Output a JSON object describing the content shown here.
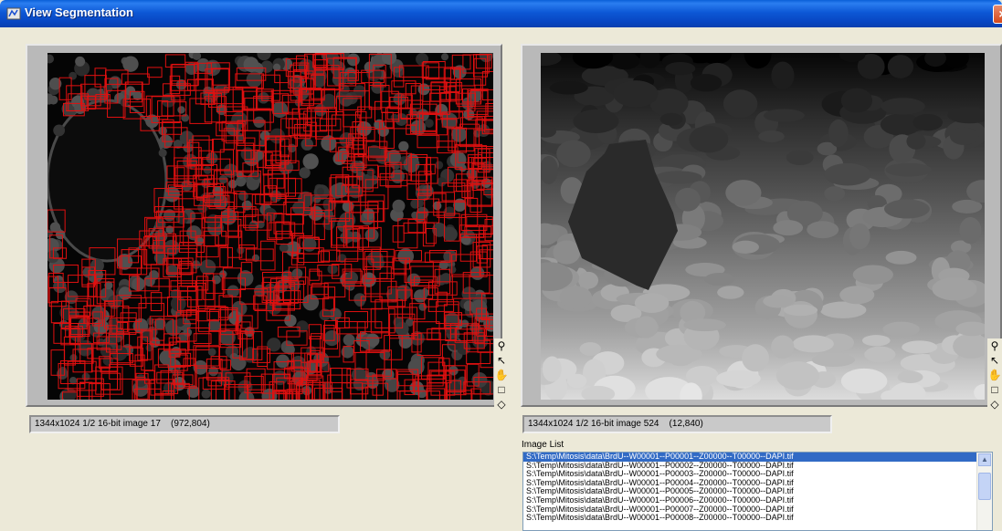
{
  "window": {
    "title": "View Segmentation",
    "close_label": "×"
  },
  "left_view": {
    "status": "1344x1024 1/2 16-bit image 17    (972,804)"
  },
  "right_view": {
    "status": "1344x1024 1/2 16-bit image 524    (12,840)"
  },
  "tools": [
    {
      "name": "zoom-icon",
      "glyph": "⚲"
    },
    {
      "name": "pointer-icon",
      "glyph": "↖"
    },
    {
      "name": "pan-hand-icon",
      "glyph": "✋"
    },
    {
      "name": "rectangle-tool-icon",
      "glyph": "□"
    },
    {
      "name": "polygon-tool-icon",
      "glyph": "◇"
    }
  ],
  "image_list": {
    "label": "Image List",
    "items": [
      "S:\\Temp\\Mitosis\\data\\BrdU--W00001--P00001--Z00000--T00000--DAPI.tif",
      "S:\\Temp\\Mitosis\\data\\BrdU--W00001--P00002--Z00000--T00000--DAPI.tif",
      "S:\\Temp\\Mitosis\\data\\BrdU--W00001--P00003--Z00000--T00000--DAPI.tif",
      "S:\\Temp\\Mitosis\\data\\BrdU--W00001--P00004--Z00000--T00000--DAPI.tif",
      "S:\\Temp\\Mitosis\\data\\BrdU--W00001--P00005--Z00000--T00000--DAPI.tif",
      "S:\\Temp\\Mitosis\\data\\BrdU--W00001--P00006--Z00000--T00000--DAPI.tif",
      "S:\\Temp\\Mitosis\\data\\BrdU--W00001--P00007--Z00000--T00000--DAPI.tif",
      "S:\\Temp\\Mitosis\\data\\BrdU--W00001--P00008--Z00000--T00000--DAPI.tif"
    ],
    "selected_index": 0
  },
  "colors": {
    "segmentation_box": "#e01010",
    "selection": "#316ac5"
  }
}
